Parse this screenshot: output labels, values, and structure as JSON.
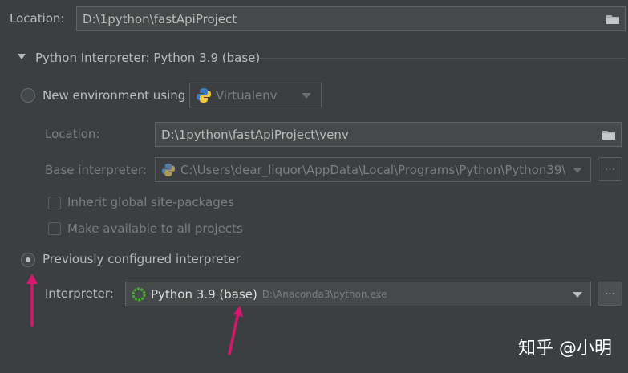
{
  "location": {
    "label": "Location:",
    "value": "D:\\1python\\fastApiProject"
  },
  "interpreter_section": {
    "title": "Python Interpreter: Python 3.9 (base)"
  },
  "new_env": {
    "label": "New environment using",
    "tool": "Virtualenv",
    "location_label": "Location:",
    "location_value": "D:\\1python\\fastApiProject\\venv",
    "base_label": "Base interpreter:",
    "base_value": "C:\\Users\\dear_liquor\\AppData\\Local\\Programs\\Python\\Python39\\",
    "inherit_label": "Inherit global site-packages",
    "make_available_label": "Make available to all projects",
    "more_button": "..."
  },
  "previous": {
    "label": "Previously configured interpreter",
    "interpreter_label": "Interpreter:",
    "interpreter_name": "Python 3.9 (base)",
    "interpreter_path": "D:\\Anaconda3\\python.exe",
    "more_button": "..."
  },
  "watermark": "知乎 @小明",
  "colors": {
    "background": "#3c3f41",
    "annotation_arrow": "#d4186e",
    "conda_ring": "#43b02a"
  }
}
